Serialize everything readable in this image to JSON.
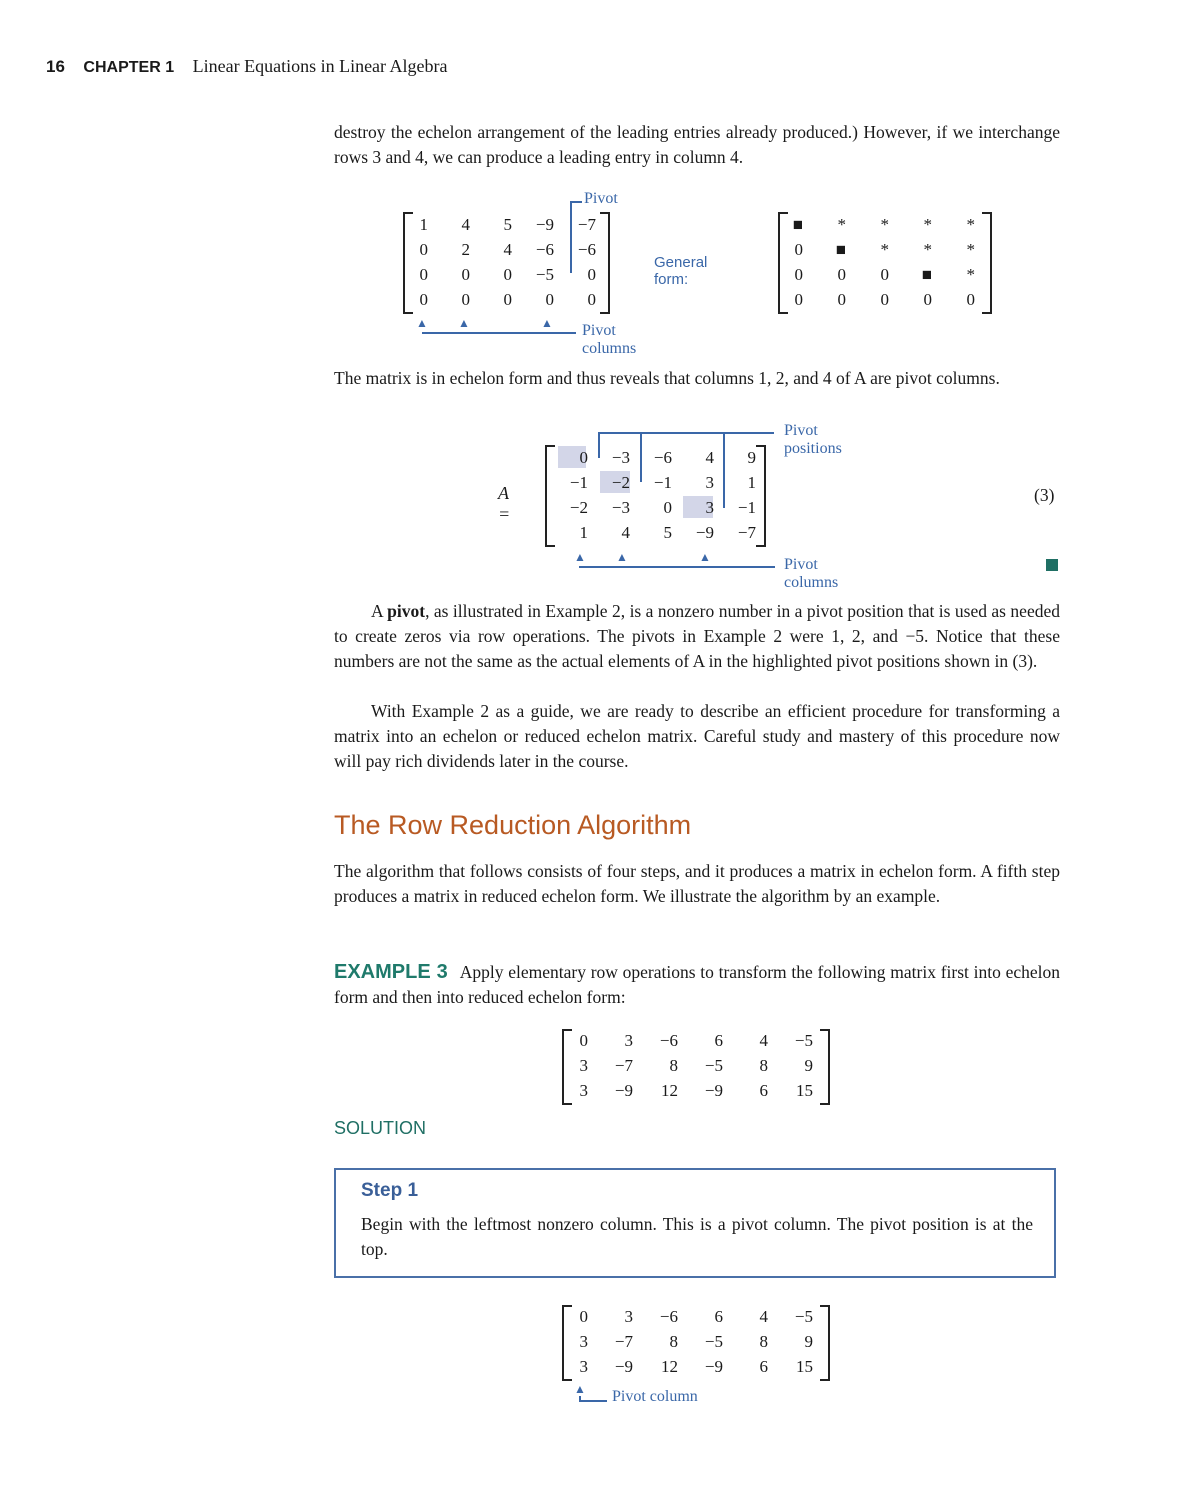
{
  "header": {
    "page_number": "16",
    "chapter": "CHAPTER 1",
    "chapter_title": "Linear Equations in Linear Algebra"
  },
  "intro_paragraph": "destroy the echelon arrangement of the leading entries already produced.) However, if we interchange rows 3 and 4, we can produce a leading entry in column 4.",
  "figure1": {
    "matrix": [
      [
        "1",
        "4",
        "5",
        "−9",
        "−7"
      ],
      [
        "0",
        "2",
        "4",
        "−6",
        "−6"
      ],
      [
        "0",
        "0",
        "0",
        "−5",
        "0"
      ],
      [
        "0",
        "0",
        "0",
        "0",
        "0"
      ]
    ],
    "pivot_label": "Pivot",
    "pivot_columns_label": "Pivot columns",
    "general_form_label": "General form:",
    "general_form": [
      [
        "■",
        "*",
        "*",
        "*",
        "*"
      ],
      [
        "0",
        "■",
        "*",
        "*",
        "*"
      ],
      [
        "0",
        "0",
        "0",
        "■",
        "*"
      ],
      [
        "0",
        "0",
        "0",
        "0",
        "0"
      ]
    ]
  },
  "paragraph2": "The matrix is in echelon form and thus reveals that columns 1, 2, and 4 of A are pivot columns.",
  "figure2": {
    "lhs": "A =",
    "matrix": [
      [
        "0",
        "−3",
        "−6",
        "4",
        "9"
      ],
      [
        "−1",
        "−2",
        "−1",
        "3",
        "1"
      ],
      [
        "−2",
        "−3",
        "0",
        "3",
        "−1"
      ],
      [
        "1",
        "4",
        "5",
        "−9",
        "−7"
      ]
    ],
    "pivot_positions_label": "Pivot positions",
    "pivot_columns_label": "Pivot columns",
    "equation_number": "(3)"
  },
  "paragraph3": {
    "prefix": "A ",
    "bold": "pivot",
    "rest": ", as illustrated in Example 2, is a nonzero number in a pivot position that is used as needed to create zeros via row operations. The pivots in Example 2 were 1, 2, and −5. Notice that these numbers are not the same as the actual elements of A in the highlighted pivot positions shown in (3)."
  },
  "paragraph4": "With Example 2 as a guide, we are ready to describe an efficient procedure for transforming a matrix into an echelon or reduced echelon matrix. Careful study and mastery of this procedure now will pay rich dividends later in the course.",
  "section_heading": "The Row Reduction Algorithm",
  "section_paragraph": "The algorithm that follows consists of four steps, and it produces a matrix in echelon form. A fifth step produces a matrix in reduced echelon form. We illustrate the algorithm by an example.",
  "example": {
    "label": "EXAMPLE 3",
    "text": "Apply elementary row operations to transform the following matrix first into echelon form and then into reduced echelon form:",
    "matrix": [
      [
        "0",
        "3",
        "−6",
        "6",
        "4",
        "−5"
      ],
      [
        "3",
        "−7",
        "8",
        "−5",
        "8",
        "9"
      ],
      [
        "3",
        "−9",
        "12",
        "−9",
        "6",
        "15"
      ]
    ]
  },
  "solution_label": "SOLUTION",
  "step1": {
    "title": "Step 1",
    "body": "Begin with the leftmost nonzero column. This is a pivot column. The pivot position is at the top."
  },
  "figure3": {
    "matrix": [
      [
        "0",
        "3",
        "−6",
        "6",
        "4",
        "−5"
      ],
      [
        "3",
        "−7",
        "8",
        "−5",
        "8",
        "9"
      ],
      [
        "3",
        "−9",
        "12",
        "−9",
        "6",
        "15"
      ]
    ],
    "pivot_column_label": "Pivot column"
  },
  "colors": {
    "heading": "#b85a23",
    "example_label": "#1f7a6b",
    "annotation": "#3a67a8",
    "step_border": "#4a70a8",
    "highlight": "#d3d6e8"
  }
}
